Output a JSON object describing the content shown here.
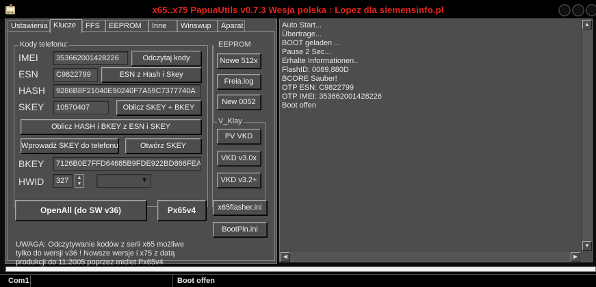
{
  "window": {
    "title": "x65..x75 PapuaUtils v0.7.3 Wesja polska : Lopez dla siemensinfo.pl",
    "title_color": "#e8241c",
    "icon": "siemens-phone-icon"
  },
  "tabs": [
    {
      "label": "Ustawienia"
    },
    {
      "label": "Klucze",
      "active": true
    },
    {
      "label": "FFS"
    },
    {
      "label": "EEPROM"
    },
    {
      "label": "Inne"
    },
    {
      "label": "Winswup"
    },
    {
      "label": "Aparat"
    }
  ],
  "codes": {
    "group_label": "Kody telefonu:",
    "imei_label": "IMEI",
    "imei_value": "353662001428226",
    "read_codes_button": "Odczytaj kody",
    "esn_label": "ESN",
    "esn_value": "C9822799",
    "esn_from_hash_button": "ESN z Hash i Skey",
    "hash_label": "HASH",
    "hash_value": "9286B8F21040E90240F7A59C7377740A",
    "skey_label": "SKEY",
    "skey_value": "10570407",
    "calc_skey_bkey_button": "Oblicz SKEY + BKEY",
    "calc_hash_bkey_button": "Oblicz HASH i BKEY z ESN i SKEY",
    "write_skey_button": "Wprowadź SKEY do telefonu",
    "open_skey_button": "Otwórz SKEY",
    "bkey_label": "BKEY",
    "bkey_value": "7126B0E7FFD64685B9FDE922BD866FEA",
    "hwid_label": "HWID",
    "hwid_value": "327",
    "hwid_combo_value": ""
  },
  "eeprom": {
    "group_label": "EEPROM",
    "new512_button": "Nowe 512x",
    "freia_button": "Freia.log",
    "new0052_button": "New 0052"
  },
  "vklay": {
    "group_label": "V_Klay",
    "pvvkd_button": "PV VKD",
    "vkd30_button": "VKD v3.0x",
    "vkd32_button": "VKD v3.2+"
  },
  "actions": {
    "openall_button": "OpenAll  (do SW v36)",
    "px65_button": "Px65v4",
    "x65flasher_button": "x65flasher.ini",
    "bootpin_button": "BootPin.ini"
  },
  "note_lines": [
    "UWAGA: Odczytywanie kodów z serii x65 możliwe",
    "tylko do wersji v36 ! Nowsze wersje i x75 z datą",
    "produkcji do 11.2005 poprzez midlet Px65v4"
  ],
  "log": [
    "Auto Start...",
    "Übertrage...",
    "BOOT geladen ...",
    "Pause 2 Sec...",
    "Erhalte Informationen..",
    "FlashID: 0089,880D",
    "BCORE Sauber!",
    "OTP ESN: C9822799",
    "OTP IMEI: 353662001428226",
    "Boot offen"
  ],
  "progress": {
    "value": 1.0
  },
  "status": {
    "port": "Com1",
    "middle": "",
    "message": "Boot offen"
  }
}
